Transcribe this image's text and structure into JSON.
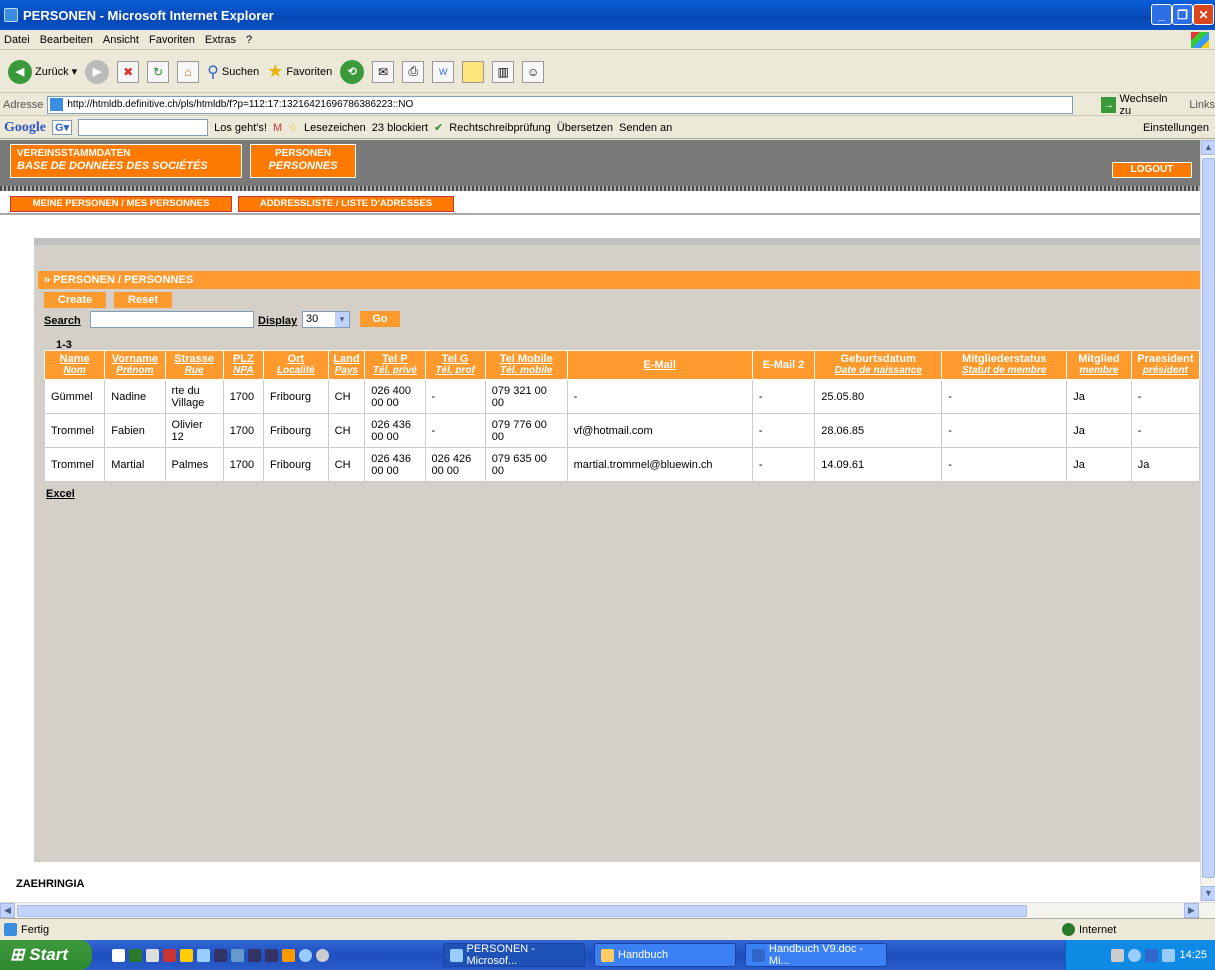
{
  "window": {
    "title": "PERSONEN - Microsoft Internet Explorer"
  },
  "menu": [
    "Datei",
    "Bearbeiten",
    "Ansicht",
    "Favoriten",
    "Extras",
    "?"
  ],
  "toolbar": {
    "back": "Zurück",
    "search": "Suchen",
    "favorites": "Favoriten"
  },
  "address": {
    "label": "Adresse",
    "url": "http://htmldb.definitive.ch/pls/htmldb/f?p=112:17:13216421696786386223::NO",
    "go": "Wechseln zu",
    "links": "Links"
  },
  "googlebar": {
    "logo": "Google",
    "g": "G",
    "go": "Los geht's!",
    "bookmarks": "Lesezeichen",
    "blocked": "23 blockiert",
    "spell": "Rechtschreibprüfung",
    "translate": "Übersetzen",
    "send": "Senden an",
    "settings": "Einstellungen"
  },
  "app": {
    "nav1_line1": "VEREINSSTAMMDATEN",
    "nav1_line2": "BASE DE DONNÉES DES SOCIÉTÉS",
    "nav2_line1": "PERSONEN",
    "nav2_line2": "PERSONNES",
    "logout": "LOGOUT",
    "subtab1": "MEINE PERSONEN / MES PERSONNES",
    "subtab2": "ADDRESSLISTE / LISTE D'ADRESSES",
    "region_title": "» PERSONEN / PERSONNES",
    "create": "Create",
    "reset": "Reset",
    "search_label": "Search",
    "display_label": "Display",
    "display_value": "30",
    "go": "Go",
    "range": "1-3",
    "excel": "Excel",
    "footer": "ZAEHRINGIA"
  },
  "table": {
    "columns": [
      {
        "main": "Name",
        "sub": "Nom"
      },
      {
        "main": "Vorname",
        "sub": "Prénom"
      },
      {
        "main": "Strasse",
        "sub": "Rue"
      },
      {
        "main": "PLZ",
        "sub": "NPA"
      },
      {
        "main": "Ort",
        "sub": "Localité"
      },
      {
        "main": "Land",
        "sub": "Pays"
      },
      {
        "main": "Tel P",
        "sub": "Tél. privé"
      },
      {
        "main": "Tel G",
        "sub": "Tél. prof"
      },
      {
        "main": "Tel Mobile",
        "sub": "Tél. mobile"
      },
      {
        "main": "E-Mail",
        "sub": ""
      },
      {
        "main": "E-Mail 2",
        "sub": ""
      },
      {
        "main": "Geburtsdatum",
        "sub": "Date de naissance"
      },
      {
        "main": "Mitgliederstatus",
        "sub": "Statut de membre"
      },
      {
        "main": "Mitglied",
        "sub": "membre"
      },
      {
        "main": "Praesident",
        "sub": "président"
      }
    ],
    "rows": [
      [
        "Gümmel",
        "Nadine",
        "rte du Village",
        "1700",
        "Fribourg",
        "CH",
        "026 400 00 00",
        "-",
        "079 321 00 00",
        "-",
        "-",
        "25.05.80",
        "-",
        "Ja",
        "-"
      ],
      [
        "Trommel",
        "Fabien",
        "Olivier 12",
        "1700",
        "Fribourg",
        "CH",
        "026 436 00 00",
        "-",
        "079 776 00 00",
        "vf@hotmail.com",
        "-",
        "28.06.85",
        "-",
        "Ja",
        "-"
      ],
      [
        "Trommel",
        "Martial",
        "Palmes",
        "1700",
        "Fribourg",
        "CH",
        "026 436 00 00",
        "026 426 00 00",
        "079 635 00 00",
        "martial.trommel@bluewin.ch",
        "-",
        "14.09.61",
        "-",
        "Ja",
        "Ja"
      ]
    ]
  },
  "status": {
    "left": "Fertig",
    "zone": "Internet"
  },
  "taskbar": {
    "start": "Start",
    "task1": "PERSONEN - Microsof...",
    "task2": "Handbuch",
    "task3": "Handbuch V9.doc - Mi...",
    "clock": "14:25"
  }
}
